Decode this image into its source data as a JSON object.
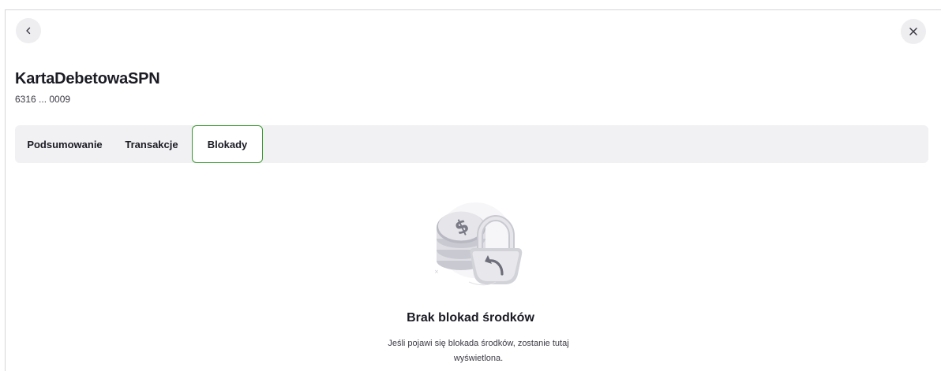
{
  "header": {
    "title": "KartaDebetowaSPN",
    "card_number": "6316 ... 0009"
  },
  "tabs": [
    {
      "label": "Podsumowanie",
      "active": false
    },
    {
      "label": "Transakcje",
      "active": false
    },
    {
      "label": "Blokady",
      "active": true
    }
  ],
  "empty_state": {
    "title": "Brak blokad środków",
    "description": "Jeśli pojawi się blokada środków, zostanie tutaj wyświetlona.",
    "illustration": "coins-lock-icon"
  },
  "icons": {
    "back": "chevron-left-icon",
    "close": "close-icon"
  },
  "colors": {
    "active_tab_border": "#3a9a2e",
    "tabbar_bg": "#f1f1f3",
    "circle_btn_bg": "#eeeef1"
  }
}
